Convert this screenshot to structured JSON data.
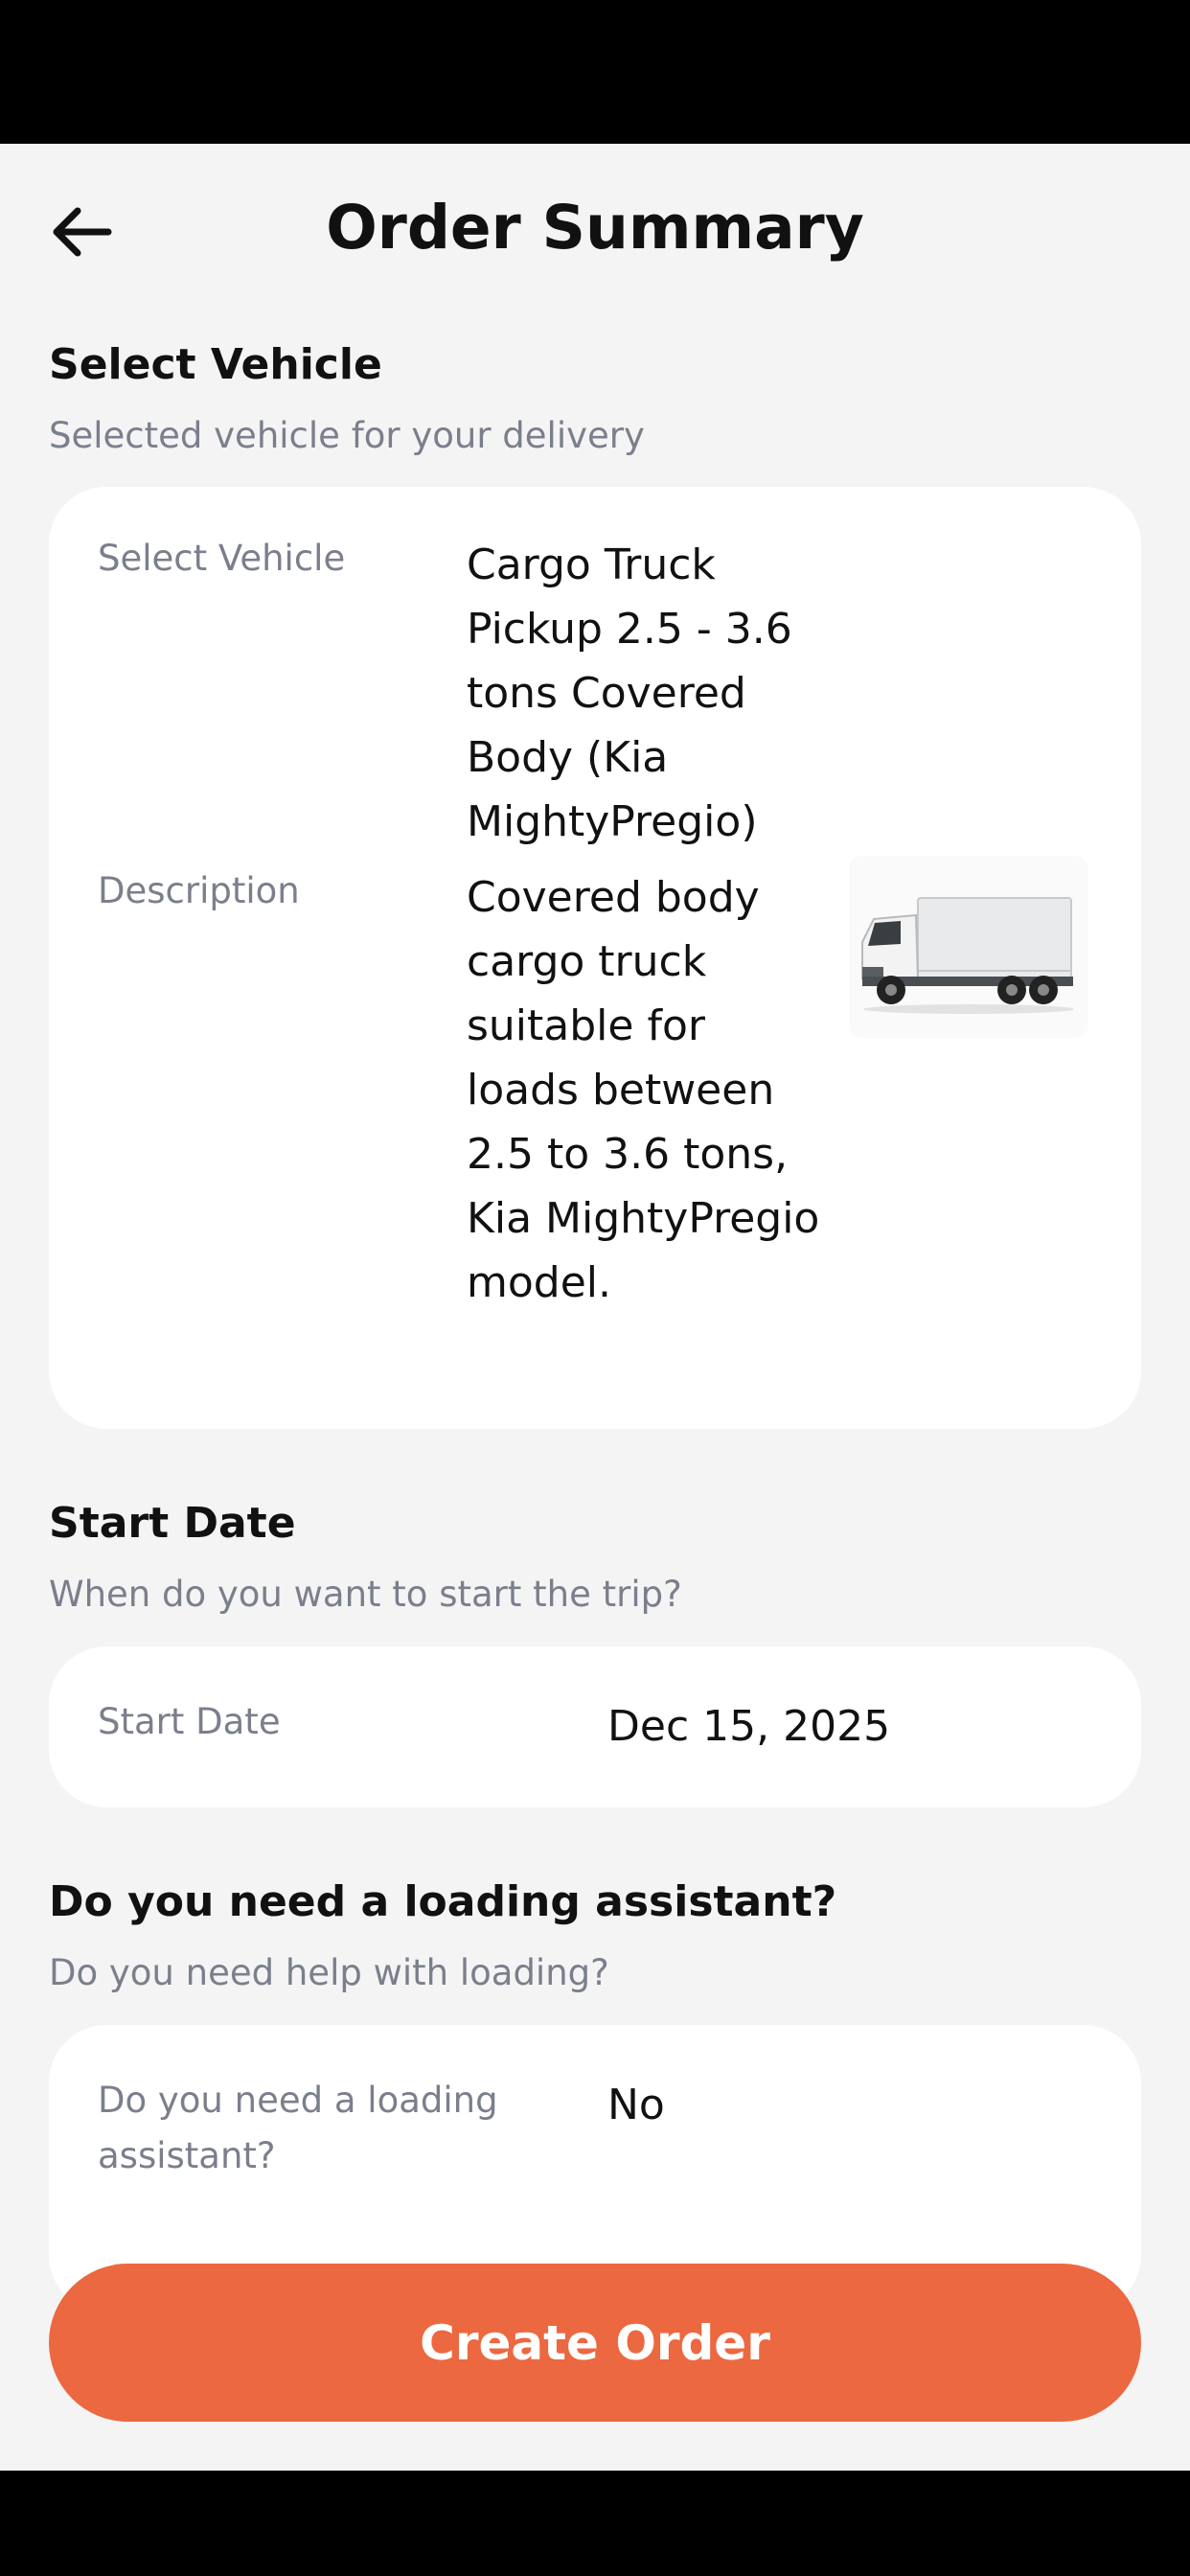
{
  "header": {
    "title": "Order Summary"
  },
  "vehicle_section": {
    "title": "Select Vehicle",
    "subtitle": "Selected vehicle for your delivery",
    "vehicle_label": "Select Vehicle",
    "vehicle_value": "Cargo Truck Pickup 2.5 - 3.6 tons Covered Body (Kia MightyPregio)",
    "description_label": "Description",
    "description_value": "Covered body cargo truck suitable for loads between 2.5 to 3.6 tons, Kia MightyPregio model.",
    "image_icon": "truck-icon"
  },
  "start_date_section": {
    "title": "Start Date",
    "subtitle": "When do you want to start the trip?",
    "label": "Start Date",
    "value": "Dec 15, 2025"
  },
  "loading_section": {
    "title": "Do you need a loading assistant?",
    "subtitle": "Do you need help with loading?",
    "label": "Do you need a loading assistant?",
    "value": "No"
  },
  "actions": {
    "create_order_label": "Create Order"
  },
  "colors": {
    "accent": "#ec6840",
    "background": "#f4f4f4",
    "card": "#ffffff",
    "muted_text": "#7b7f8c"
  }
}
